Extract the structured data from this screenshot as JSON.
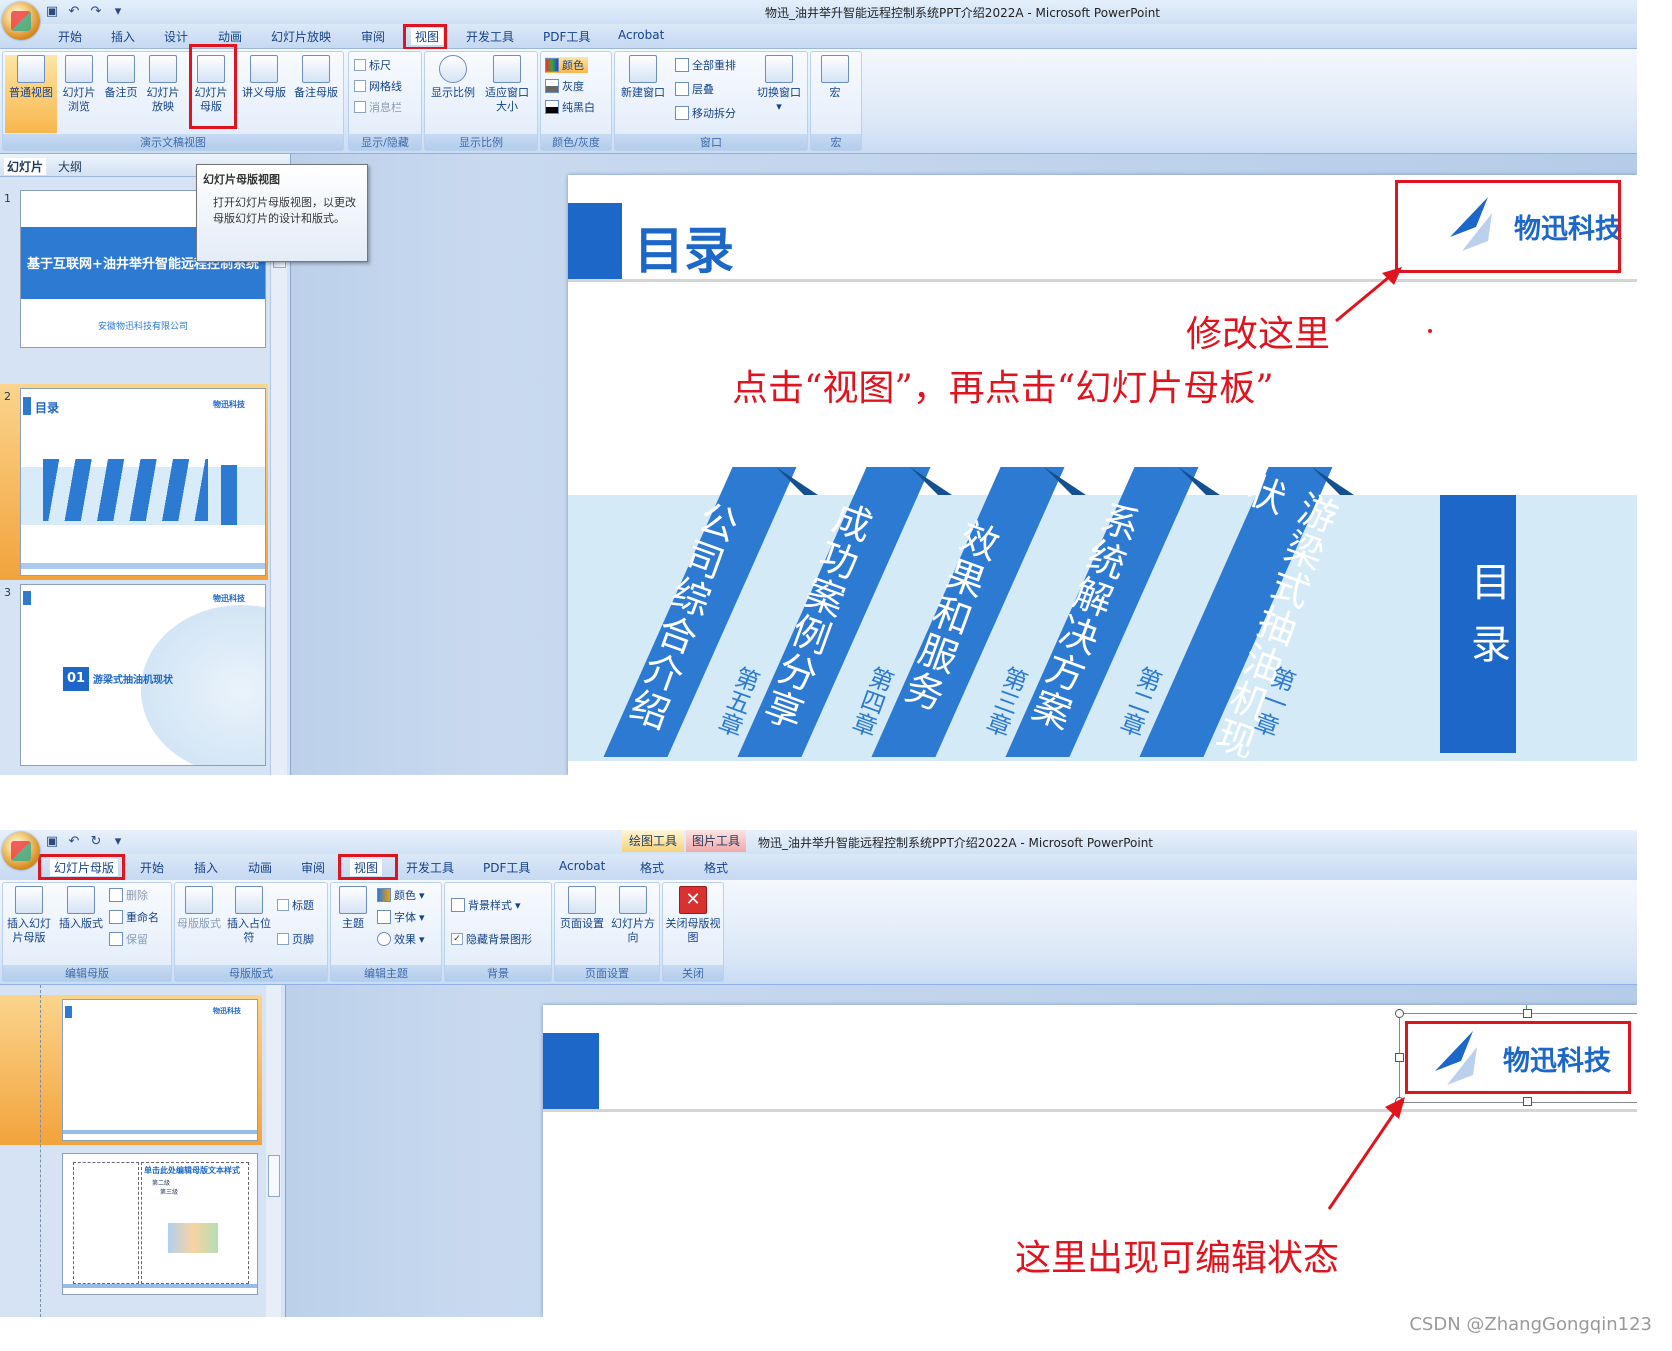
{
  "top": {
    "window_title": "物迅_油井举升智能远程控制系统PPT介绍2022A - Microsoft PowerPoint",
    "tabs": [
      "开始",
      "插入",
      "设计",
      "动画",
      "幻灯片放映",
      "审阅",
      "视图",
      "开发工具",
      "PDF工具",
      "Acrobat"
    ],
    "active_tab": "视图",
    "groups": {
      "presentation_views": {
        "label": "演示文稿视图",
        "buttons": [
          "普通视图",
          "幻灯片浏览",
          "备注页",
          "幻灯片放映",
          "幻灯片母版",
          "讲义母版",
          "备注母版"
        ]
      },
      "show_hide": {
        "label": "显示/隐藏",
        "items": [
          "标尺",
          "网格线",
          "消息栏"
        ]
      },
      "zoom": {
        "label": "显示比例",
        "buttons": [
          "显示比例",
          "适应窗口大小"
        ]
      },
      "color": {
        "label": "颜色/灰度",
        "items": [
          "颜色",
          "灰度",
          "纯黑白"
        ]
      },
      "window": {
        "label": "窗口",
        "new_window": "新建窗口",
        "items": [
          "全部重排",
          "层叠",
          "移动拆分"
        ],
        "switch": "切换窗口"
      },
      "macro": {
        "label": "宏",
        "button": "宏"
      }
    },
    "tooltip": {
      "title": "幻灯片母版视图",
      "body": "打开幻灯片母版视图，以更改母版幻灯片的设计和版式。"
    },
    "panel_tabs": [
      "幻灯片",
      "大纲"
    ],
    "thumbs": [
      {
        "num": "1",
        "title": "基于互联网+油井举升智能远程控制系统",
        "subtitle": "安徽物迅科技有限公司"
      },
      {
        "num": "2",
        "title": "目录",
        "brand": "物迅科技"
      },
      {
        "num": "3",
        "brand": "物迅科技",
        "section_num": "01",
        "section_title": "游梁式抽油机现状"
      }
    ],
    "slide": {
      "title": "目录",
      "brand": "物迅科技",
      "bands": [
        {
          "text": "公司综合介绍",
          "chapter": "第五章"
        },
        {
          "text": "成功案例分享",
          "chapter": "第四章"
        },
        {
          "text": "效果和服务",
          "chapter": "第三章"
        },
        {
          "text": "系统解决方案",
          "chapter": "第二章"
        },
        {
          "text": "游梁式抽油机现状",
          "chapter": "第一章"
        }
      ],
      "side_label": "目录"
    },
    "annotation1": "修改这里",
    "annotation2": "点击“视图”，再点击“幻灯片母板”"
  },
  "bottom": {
    "window_title": "物迅_油井举升智能远程控制系统PPT介绍2022A - Microsoft PowerPoint",
    "context_tabs": [
      "绘图工具",
      "图片工具"
    ],
    "tabs": [
      "幻灯片母版",
      "开始",
      "插入",
      "动画",
      "审阅",
      "视图",
      "开发工具",
      "PDF工具",
      "Acrobat",
      "格式",
      "格式"
    ],
    "groups": {
      "edit_master": {
        "label": "编辑母版",
        "buttons": [
          "插入幻灯片母版",
          "插入版式"
        ],
        "items": [
          "删除",
          "重命名",
          "保留"
        ]
      },
      "master_layout": {
        "label": "母版版式",
        "buttons": [
          "母版版式",
          "插入占位符"
        ],
        "items": [
          "标题",
          "页脚"
        ]
      },
      "edit_theme": {
        "label": "编辑主题",
        "button": "主题",
        "items": [
          "颜色",
          "字体",
          "效果"
        ]
      },
      "background": {
        "label": "背景",
        "items": [
          "背景样式",
          "隐藏背景图形"
        ]
      },
      "page_setup": {
        "label": "页面设置",
        "buttons": [
          "页面设置",
          "幻灯片方向"
        ]
      },
      "close": {
        "label": "关闭",
        "button": "关闭母版视图"
      }
    },
    "thumb2_text": "单击此处编辑母版文本样式",
    "thumb2_levels": [
      "第二级",
      "第三级"
    ],
    "slide": {
      "brand": "物迅科技"
    },
    "annotation": "这里出现可编辑状态"
  },
  "watermark": "CSDN @ZhangGongqin123"
}
